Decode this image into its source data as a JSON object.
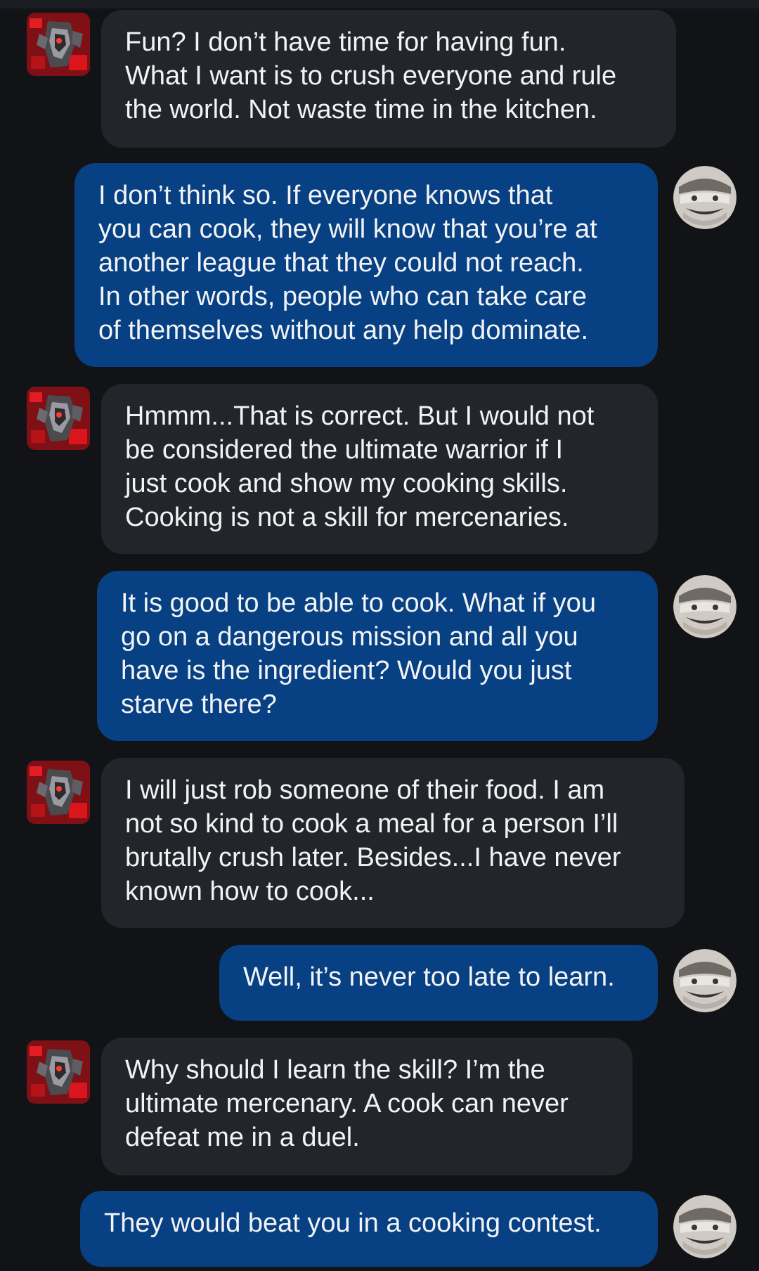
{
  "colors": {
    "background": "#121316",
    "bot_bubble": "#23252b",
    "user_bubble": "#074083",
    "text": "#f2f3f5",
    "bot_avatar_accent": "#c4161c"
  },
  "icons": {
    "bot_avatar": "bot-avatar-icon",
    "user_avatar": "user-avatar-icon"
  },
  "messages": [
    {
      "sender": "bot",
      "text": "Fun? I don’t have time for having fun.\nWhat I want is to crush everyone and rule\nthe world. Not waste time in the kitchen."
    },
    {
      "sender": "user",
      "text": "I don’t think so. If everyone knows that\nyou can cook, they will know that you’re at\nanother league that they could not reach.\nIn other words, people who can take care\nof themselves without any help dominate."
    },
    {
      "sender": "bot",
      "text": "Hmmm...That is correct. But I would not\nbe considered the ultimate warrior if I\njust cook and show my cooking skills.\nCooking is not a skill for mercenaries."
    },
    {
      "sender": "user",
      "text": "It is good to be able to cook. What if you\ngo on a dangerous mission and all you\nhave is the ingredient? Would you just\nstarve there?"
    },
    {
      "sender": "bot",
      "text": "I will just rob someone of their food. I am\nnot so kind to cook a meal for a person I’ll\nbrutally crush later. Besides...I have never\nknown how to cook..."
    },
    {
      "sender": "user",
      "text": "Well, it’s never too late to learn."
    },
    {
      "sender": "bot",
      "text": "Why should I learn the skill? I’m the\nultimate mercenary. A cook can never\ndefeat me in a duel."
    },
    {
      "sender": "user",
      "text": "They would beat you in a cooking contest."
    }
  ]
}
